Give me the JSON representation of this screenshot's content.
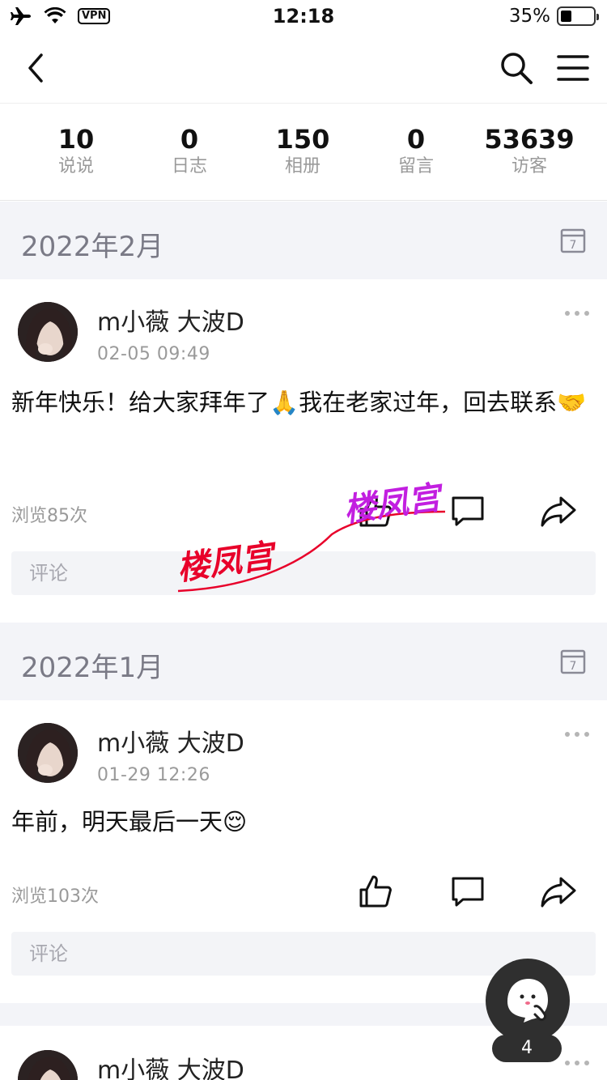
{
  "status_bar": {
    "time": "12:18",
    "vpn": "VPN",
    "battery": "35%",
    "battery_level": 0.35
  },
  "stats": [
    {
      "count": "10",
      "label": "说说"
    },
    {
      "count": "0",
      "label": "日志"
    },
    {
      "count": "150",
      "label": "相册"
    },
    {
      "count": "0",
      "label": "留言"
    },
    {
      "count": "53639",
      "label": "访客"
    }
  ],
  "months": [
    {
      "label": "2022年2月",
      "calendar_day": "7"
    },
    {
      "label": "2022年1月",
      "calendar_day": "7"
    }
  ],
  "posts": [
    {
      "author": "m小薇  大波D",
      "time": "02-05 09:49",
      "text": "新年快乐！给大家拜年了🙏我在老家过年，回去联系🤝",
      "views": "浏览85次",
      "comment_placeholder": "评论"
    },
    {
      "author": "m小薇  大波D",
      "time": "01-29 12:26",
      "text": "年前，明天最后一天😌",
      "views": "浏览103次",
      "comment_placeholder": "评论"
    },
    {
      "author": "m小薇  大波D"
    }
  ],
  "watermark": {
    "text_1": "楼凤宫",
    "text_2": "楼凤宫"
  },
  "floating_badge": "4",
  "colors": {
    "month_bg": "#f3f4f8",
    "watermark_red": "#e8002a",
    "watermark_purple": "#c21fe0"
  }
}
